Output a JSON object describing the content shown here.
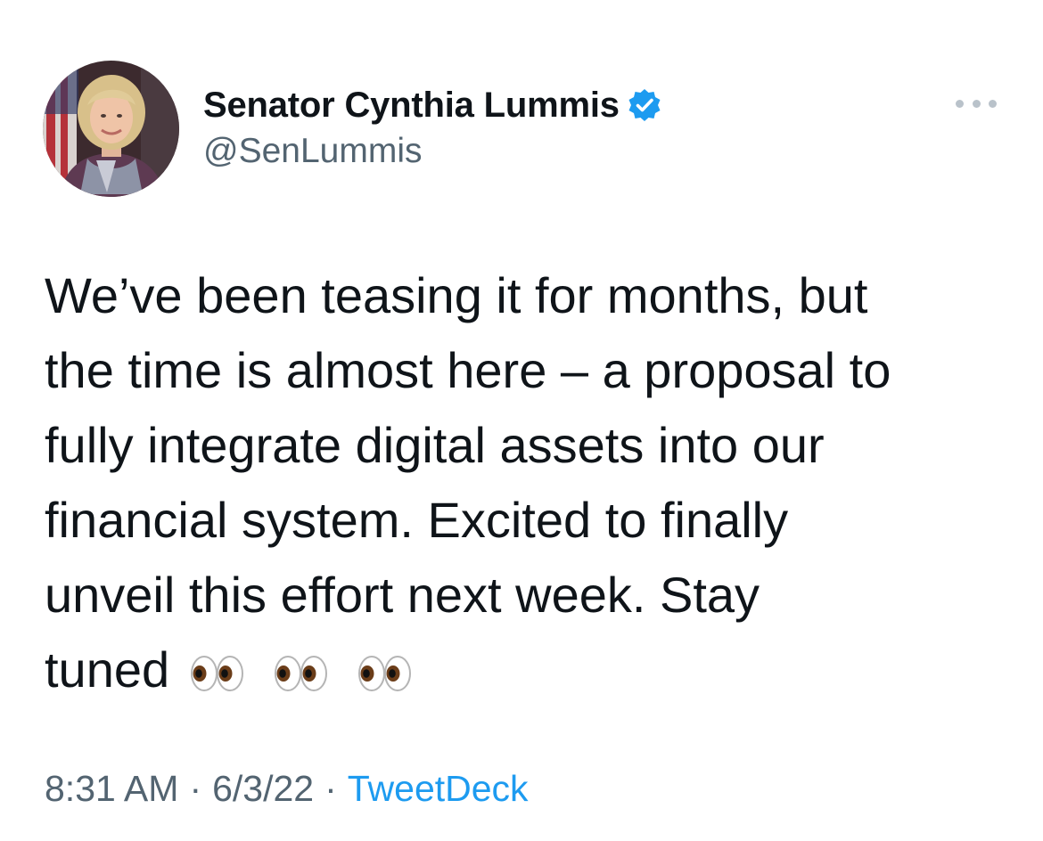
{
  "author": {
    "display_name": "Senator Cynthia Lummis",
    "handle": "@SenLummis",
    "verified": true,
    "verified_color": "#1d9bf0"
  },
  "more_icon": "more-horizontal-icon",
  "tweet": {
    "lines": [
      "We’ve been teasing it for months, but",
      "the time is almost here – a proposal to",
      "fully integrate digital assets into our",
      "financial system. Excited to finally",
      "unveil this effort next week. Stay",
      "tuned"
    ],
    "emojis": [
      "eyes-emoji",
      "eyes-emoji",
      "eyes-emoji"
    ]
  },
  "meta": {
    "time": "8:31 AM",
    "separator": "·",
    "date": "6/3/22",
    "source": "TweetDeck",
    "source_color": "#1d9bf0"
  }
}
